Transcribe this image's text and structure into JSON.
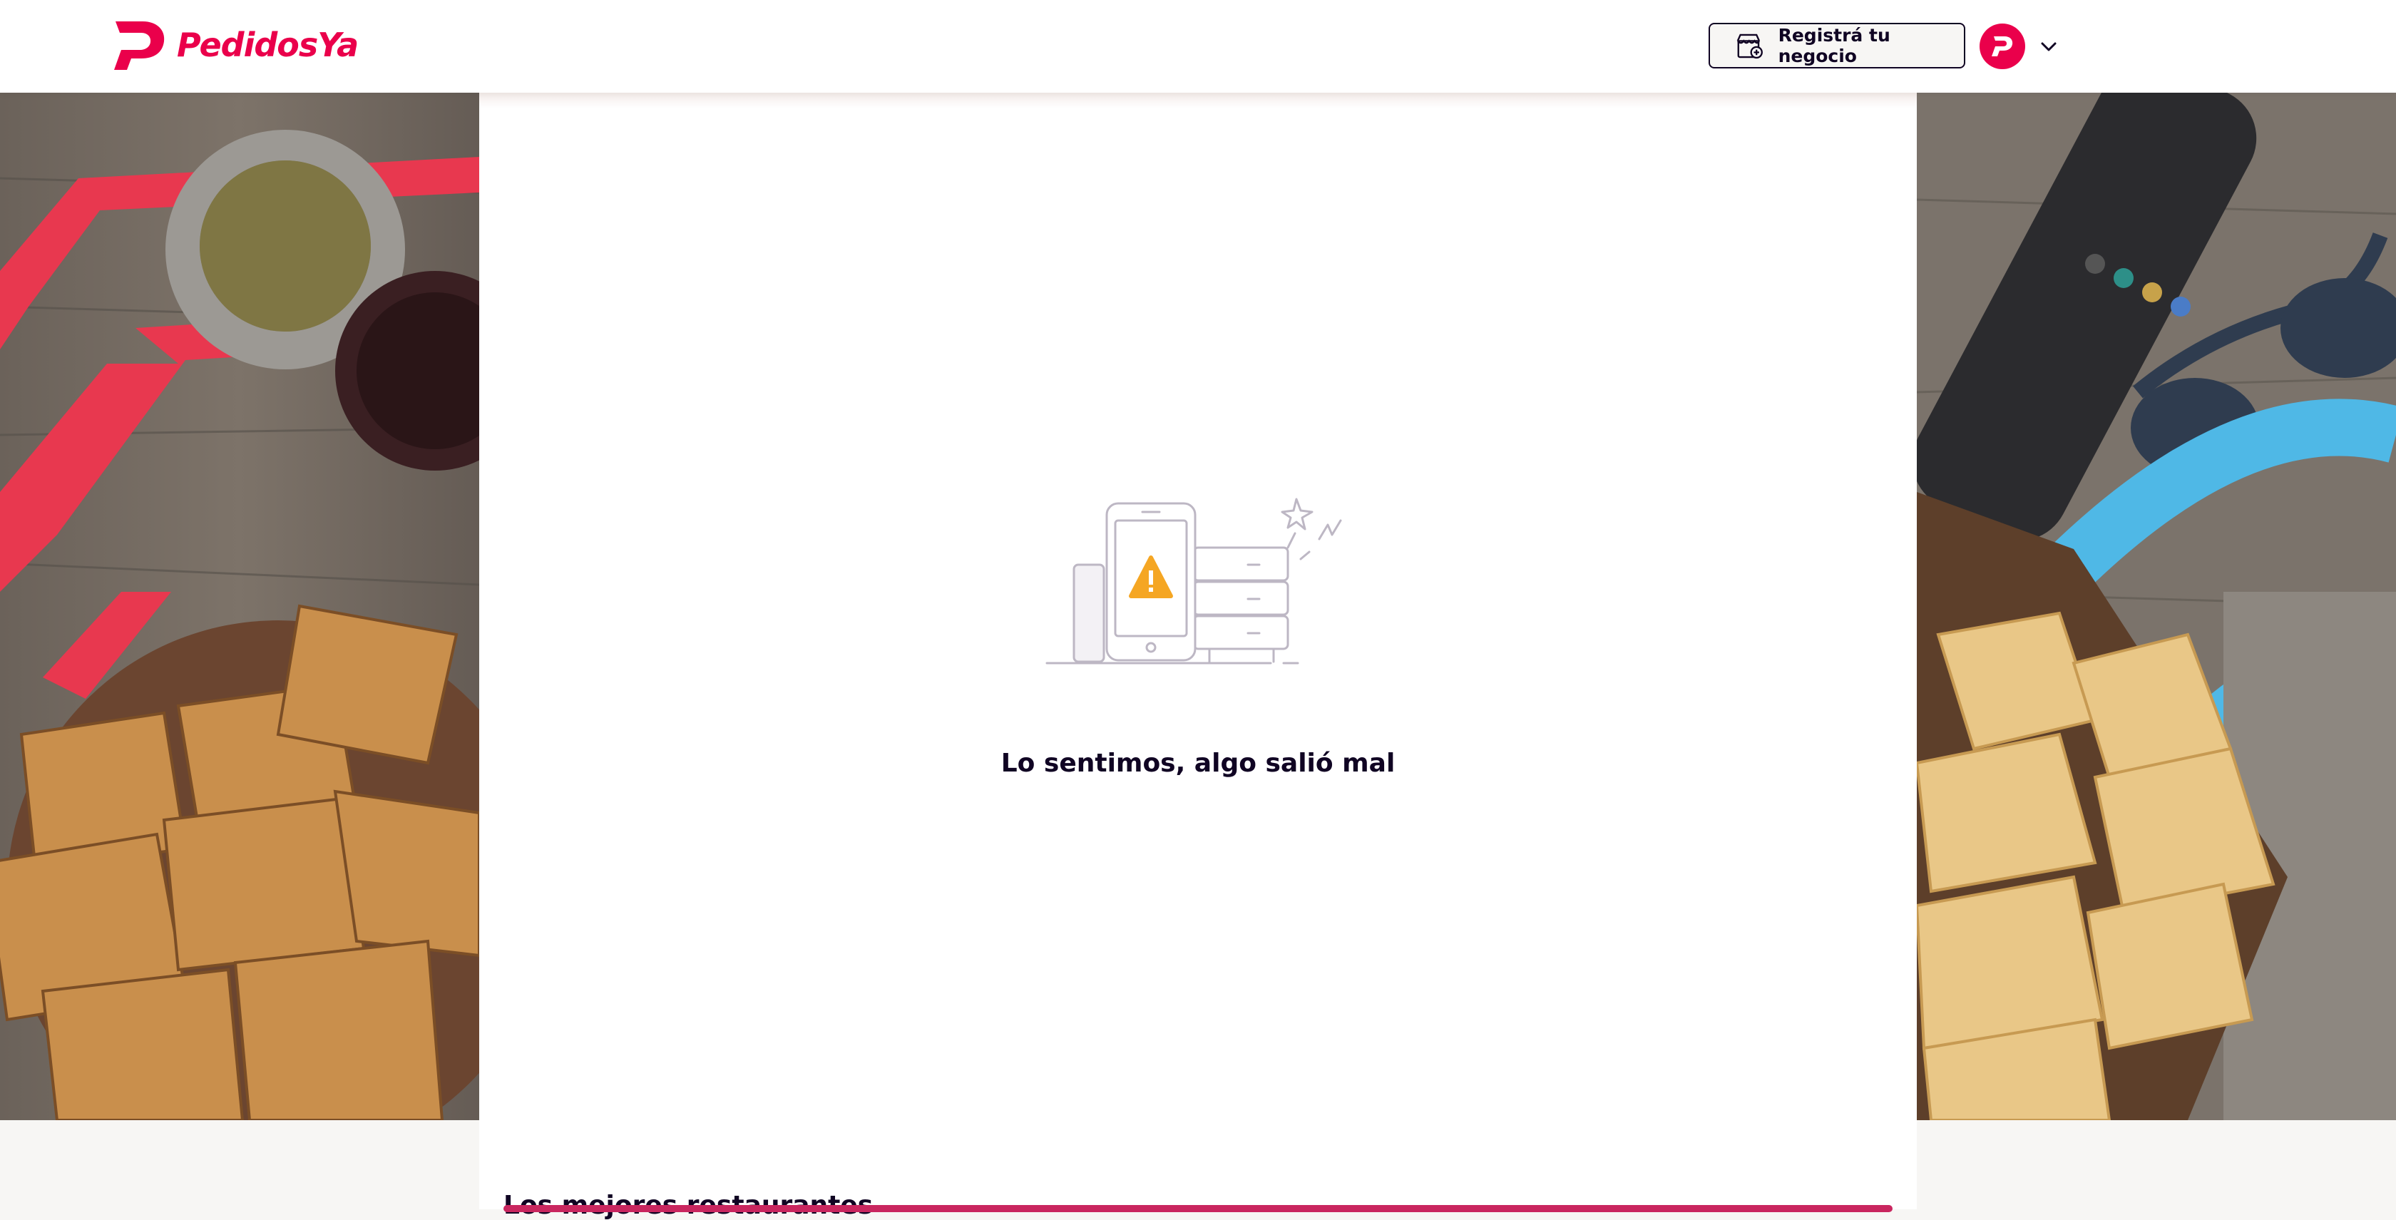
{
  "header": {
    "brand": "PedidosYa",
    "register_button": "Registrá tu negocio",
    "avatar_letter": "P"
  },
  "error": {
    "message": "Lo sentimos, algo salió mal"
  },
  "section": {
    "heading": "Los mejores restaurantes"
  },
  "colors": {
    "brand": "#ea004b",
    "text": "#100423",
    "warning": "#f5a623",
    "accent_blue": "#4fb8e6"
  },
  "icons": {
    "logo": "pedidosya-logo-icon",
    "register": "store-icon",
    "avatar": "user-avatar-icon",
    "dropdown": "chevron-down-icon",
    "illustration": "phone-warning-servers-icon"
  }
}
